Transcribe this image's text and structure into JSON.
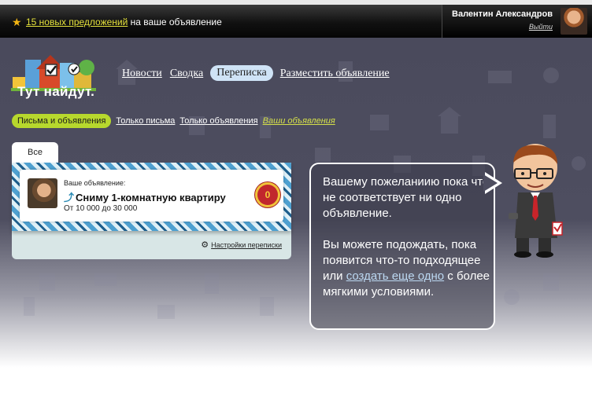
{
  "topbar": {
    "offers_link": "15 новых предложений",
    "offers_text": " на ваше объявление",
    "user_name": "Валентин Александров",
    "logout_label": "Выйти"
  },
  "logo": {
    "title": "Тут найдут."
  },
  "nav": {
    "items": [
      {
        "label": "Новости"
      },
      {
        "label": "Сводка"
      },
      {
        "label": "Переписка"
      },
      {
        "label": "Разместить объявление"
      }
    ]
  },
  "subnav": {
    "items": [
      {
        "label": "Письма и объявления"
      },
      {
        "label": "Только письма"
      },
      {
        "label": "Только объявления"
      },
      {
        "label": "Ваши объявления"
      }
    ]
  },
  "card": {
    "tab_label": "Все",
    "ad_caption": "Ваше объявление:",
    "ad_title": "Сниму 1-комнатную квартиру",
    "ad_price": "От 10 000 до 30 000",
    "ad_badge": "0",
    "settings_label": "Настройки переписки"
  },
  "bubble": {
    "p1": "Вашему пожеланиию пока что не соответствует ни одно объявление.",
    "p2_before": "Вы можете подождать, пока появится что-то подходящее или ",
    "p2_link": "создать еще одно",
    "p2_after": " с более мягкими условиями."
  },
  "colors": {
    "accent_green": "#b7d82d",
    "link_yellow": "#e4e13b",
    "nav_active": "#cfe3f6",
    "badge_red": "#c1272d"
  }
}
